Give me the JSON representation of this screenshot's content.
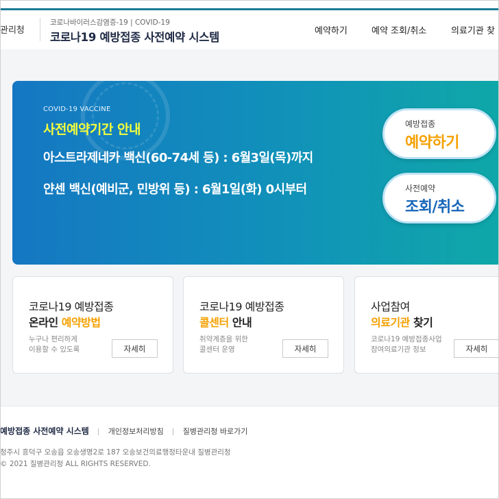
{
  "header": {
    "brand": "관리청",
    "subtitle": "코로나바이러스감염증-19 | COVID-19",
    "system_name": "코로나19 예방접종 사전예약 시스템",
    "nav": [
      "예약하기",
      "예약 조회/취소",
      "의료기관 찾"
    ]
  },
  "hero": {
    "eyebrow": "COVID-19 VACCINE",
    "title": "사전예약기간 안내",
    "line1": "아스트라제네카 백신(60-74세 등) : 6월3일(목)까지",
    "line2": "얀센 백신(예비군, 민방위 등) : 6월1일(화) 0시부터",
    "pills": [
      {
        "small": "예방접종",
        "big": "예약하기"
      },
      {
        "small": "사전예약",
        "big": "조회/취소"
      }
    ]
  },
  "cards": [
    {
      "t1": "코로나19 예방접종",
      "t2_plain": "온라인 ",
      "t2_hl": "예약방법",
      "t2_after": "",
      "desc1": "누구나 편리하게",
      "desc2": "이용할 수 있도록",
      "button": "자세히"
    },
    {
      "t1": "코로나19 예방접종",
      "t2_plain": "",
      "t2_hl": "콜센터",
      "t2_after": " 안내",
      "desc1": "취약계층을 위한",
      "desc2": "콜센터 운영",
      "button": "자세히"
    },
    {
      "t1": "사업참여",
      "t2_plain": "",
      "t2_hl": "의료기관",
      "t2_after": " 찾기",
      "desc1": "코로나19 예방접종사업",
      "desc2": "참여의료기관 정보",
      "button": "자세히"
    }
  ],
  "footer": {
    "system_name": "예방접종 사전예약 시스템",
    "privacy": "개인정보처리방침",
    "kdca_link": "질병관리청 바로가기",
    "address": "청주시 흥덕구 오송읍 오송생명2로 187 오송보건의료행정타운내 질병관리청",
    "copyright": "© 2021 질병관리청 ALL RIGHTS RESERVED."
  },
  "colors": {
    "accent_orange": "#f5a000",
    "accent_blue": "#1565b8",
    "hero_yellow": "#f6ff3a",
    "top_line": "#1a7a94"
  }
}
